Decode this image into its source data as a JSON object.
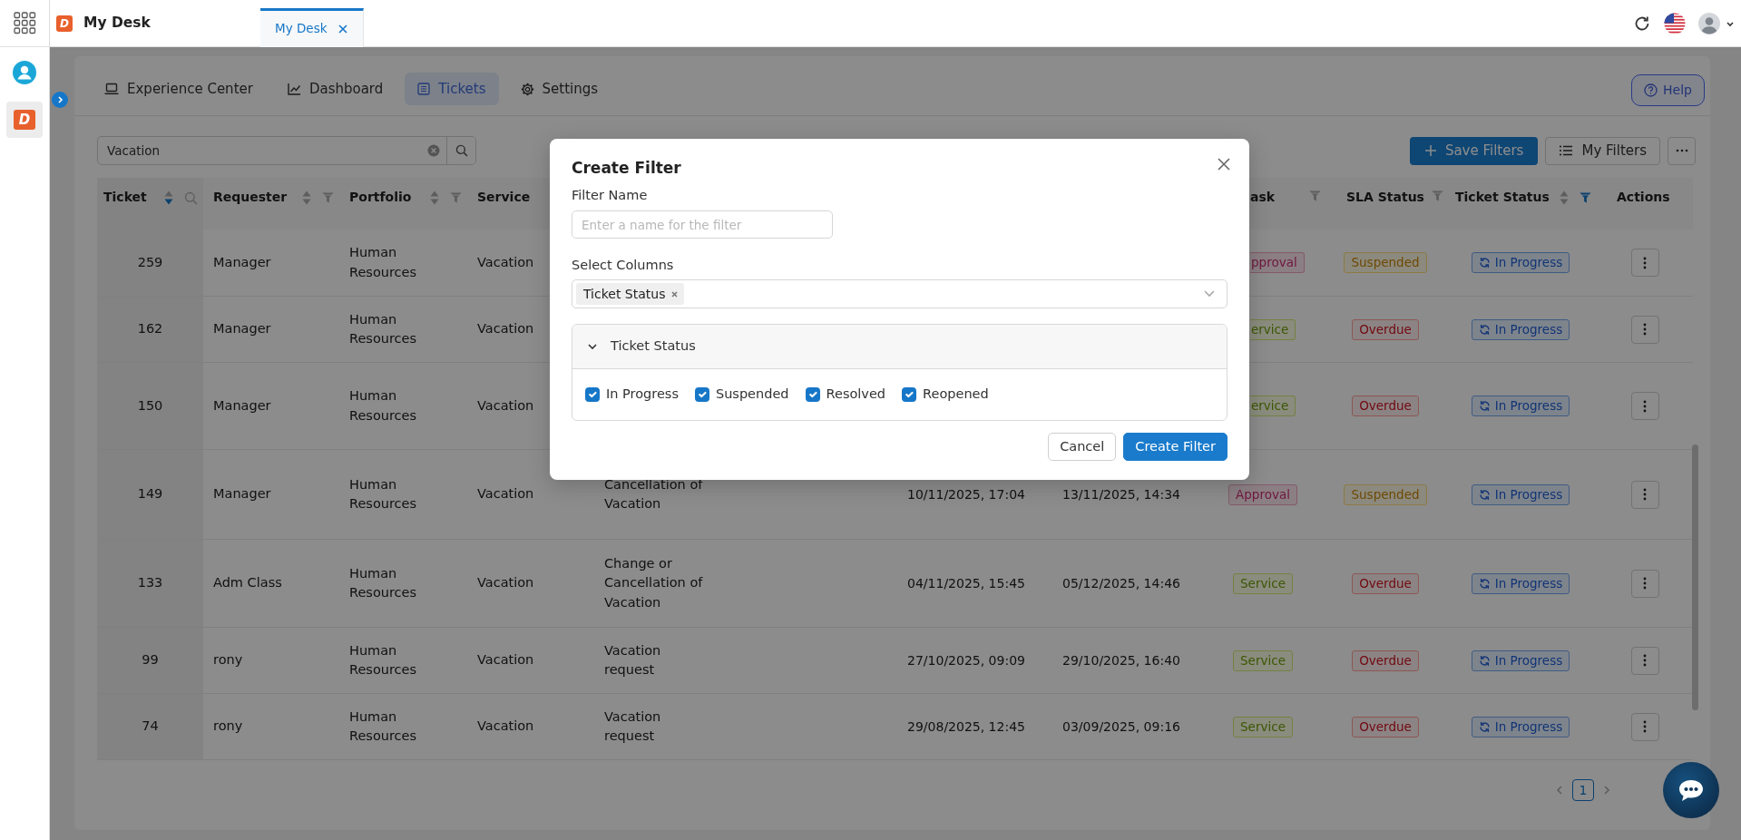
{
  "rail": [
    {
      "kind": "profile",
      "selected": false
    },
    {
      "kind": "app",
      "selected": true,
      "logo": "D"
    }
  ],
  "app": {
    "logo": "D",
    "title": "My Desk"
  },
  "tabs": [
    {
      "label": "My Desk",
      "selected": true
    }
  ],
  "nav": [
    {
      "label": "Experience Center",
      "selected": false
    },
    {
      "label": "Dashboard",
      "selected": false
    },
    {
      "label": "Tickets",
      "selected": true
    },
    {
      "label": "Settings",
      "selected": false
    }
  ],
  "help_button": "Help",
  "search": {
    "value": "Vacation"
  },
  "toolbar": {
    "save_filters": "Save Filters",
    "my_filters": "My Filters"
  },
  "table": {
    "columns": [
      {
        "label": "Ticket",
        "sortable": true,
        "sorted": true,
        "searchable": true
      },
      {
        "label": "Requester",
        "sortable": true,
        "sorted": false,
        "filterable": true,
        "filtered": false
      },
      {
        "label": "Portfolio",
        "sortable": true,
        "sorted": false,
        "filterable": true,
        "filtered": false
      },
      {
        "label": "Service"
      },
      {
        "label": "ask",
        "filterable": true,
        "filtered": false
      },
      {
        "label": "SLA Status",
        "filterable": true,
        "filtered": false
      },
      {
        "label": "Ticket Status",
        "sortable": true,
        "sorted": false,
        "filterable": true,
        "filtered": true
      },
      {
        "label": "Actions"
      }
    ],
    "rows": [
      {
        "ticket": "259",
        "requester": "Manager",
        "portfolio": "Human Resources",
        "service": "Vacation",
        "task": {
          "label": "pproval",
          "kind": "approval",
          "cut": true
        },
        "sla": {
          "label": "Suspended",
          "kind": "suspended"
        },
        "status": {
          "label": "In Progress",
          "kind": "in-progress"
        }
      },
      {
        "ticket": "162",
        "requester": "Manager",
        "portfolio": "Human Resources",
        "service": "Vacation",
        "task": {
          "label": "ervice",
          "kind": "service",
          "cut": true
        },
        "sla": {
          "label": "Overdue",
          "kind": "overdue"
        },
        "status": {
          "label": "In Progress",
          "kind": "in-progress"
        }
      },
      {
        "ticket": "150",
        "requester": "Manager",
        "portfolio": "Human Resources",
        "service": "Vacation",
        "task": {
          "label": "ervice",
          "kind": "service",
          "cut": true
        },
        "sla": {
          "label": "Overdue",
          "kind": "overdue"
        },
        "status": {
          "label": "In Progress",
          "kind": "in-progress"
        }
      },
      {
        "ticket": "149",
        "requester": "Manager",
        "portfolio": "Human Resources",
        "service": "Vacation",
        "column_5": "Cancellation of Vacation",
        "column_6": "10/11/2025, 17:04",
        "column_7": "13/11/2025, 14:34",
        "task": {
          "label": "Approval",
          "kind": "approval",
          "cut": false
        },
        "sla": {
          "label": "Suspended",
          "kind": "suspended"
        },
        "status": {
          "label": "In Progress",
          "kind": "in-progress"
        }
      },
      {
        "ticket": "133",
        "requester": "Adm Class",
        "portfolio": "Human Resources",
        "service": "Vacation",
        "column_5": "Change or Cancellation of Vacation",
        "column_6": "04/11/2025, 15:45",
        "column_7": "05/12/2025, 14:46",
        "task": {
          "label": "Service",
          "kind": "service",
          "cut": false
        },
        "sla": {
          "label": "Overdue",
          "kind": "overdue"
        },
        "status": {
          "label": "In Progress",
          "kind": "in-progress"
        }
      },
      {
        "ticket": "99",
        "requester": "rony",
        "portfolio": "Human Resources",
        "service": "Vacation",
        "column_5": "Vacation request",
        "column_6": "27/10/2025, 09:09",
        "column_7": "29/10/2025, 16:40",
        "task": {
          "label": "Service",
          "kind": "service",
          "cut": false
        },
        "sla": {
          "label": "Overdue",
          "kind": "overdue"
        },
        "status": {
          "label": "In Progress",
          "kind": "in-progress"
        }
      },
      {
        "ticket": "74",
        "requester": "rony",
        "portfolio": "Human Resources",
        "service": "Vacation",
        "column_5": "Vacation request",
        "column_6": "29/08/2025, 12:45",
        "column_7": "03/09/2025, 09:16",
        "task": {
          "label": "Service",
          "kind": "service",
          "cut": false
        },
        "sla": {
          "label": "Overdue",
          "kind": "overdue"
        },
        "status": {
          "label": "In Progress",
          "kind": "in-progress"
        }
      }
    ]
  },
  "pagination": [
    {
      "label": "1",
      "selected": true
    }
  ],
  "modal": {
    "title": "Create Filter",
    "filter_name": {
      "label": "Filter Name",
      "placeholder": "Enter a name for the filter"
    },
    "select_columns": {
      "label": "Select Columns",
      "chips": [
        "Ticket Status"
      ]
    },
    "groups": [
      {
        "title": "Ticket Status",
        "expanded": true,
        "options": [
          {
            "label": "In Progress",
            "checked": true
          },
          {
            "label": "Suspended",
            "checked": true
          },
          {
            "label": "Resolved",
            "checked": true
          },
          {
            "label": "Reopened",
            "checked": true
          }
        ]
      }
    ],
    "buttons": [
      {
        "label": "Cancel",
        "kind": "secondary"
      },
      {
        "label": "Create Filter",
        "kind": "primary"
      }
    ]
  }
}
